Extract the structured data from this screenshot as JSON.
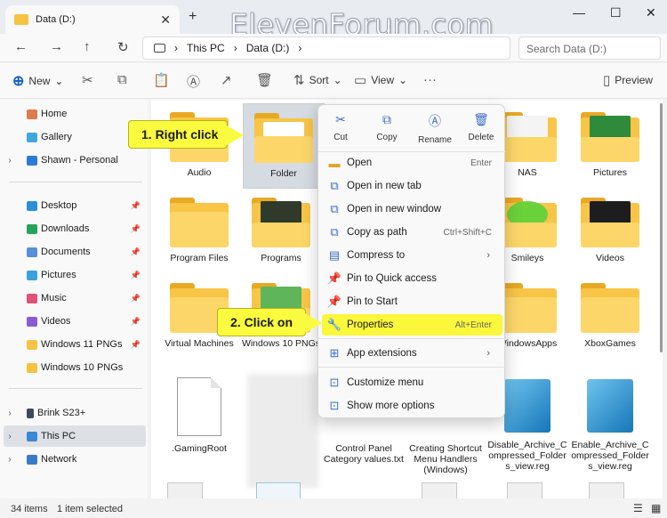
{
  "window": {
    "tab_title": "Data (D:)",
    "watermark": "ElevenForum.com"
  },
  "address": {
    "crumbs": [
      "This PC",
      "Data (D:)"
    ],
    "search_placeholder": "Search Data (D:)"
  },
  "toolbar": {
    "new_label": "New",
    "sort_label": "Sort",
    "view_label": "View",
    "preview_label": "Preview"
  },
  "sidebar": {
    "items": [
      {
        "label": "Home"
      },
      {
        "label": "Gallery"
      },
      {
        "label": "Shawn - Personal"
      },
      {
        "label": "Desktop"
      },
      {
        "label": "Downloads"
      },
      {
        "label": "Documents"
      },
      {
        "label": "Pictures"
      },
      {
        "label": "Music"
      },
      {
        "label": "Videos"
      },
      {
        "label": "Windows 11 PNGs"
      },
      {
        "label": "Windows 10 PNGs"
      },
      {
        "label": "Brink S23+"
      },
      {
        "label": "This PC"
      },
      {
        "label": "Network"
      }
    ]
  },
  "files": {
    "row1": [
      "Audio",
      "Folder",
      "NAS",
      "Pictures"
    ],
    "row2": [
      "Program Files",
      "Programs",
      "Smileys",
      "Videos"
    ],
    "row3": [
      "Virtual Machines",
      "Windows 10 PNGs",
      "WindowsApps",
      "XboxGames"
    ],
    "row4": [
      ".GamingRoot",
      "Control Panel Category values.txt",
      "Creating Shortcut Menu Handlers (Windows)",
      "Disable_Archive_Compressed_Folders_view.reg",
      "Enable_Archive_Compressed_Folders_view.reg"
    ]
  },
  "context_menu": {
    "quick_actions": [
      "Cut",
      "Copy",
      "Rename",
      "Delete"
    ],
    "items": [
      {
        "label": "Open",
        "shortcut": "Enter"
      },
      {
        "label": "Open in new tab",
        "shortcut": ""
      },
      {
        "label": "Open in new window",
        "shortcut": ""
      },
      {
        "label": "Copy as path",
        "shortcut": "Ctrl+Shift+C"
      },
      {
        "label": "Compress to",
        "shortcut": ""
      },
      {
        "label": "Pin to Quick access",
        "shortcut": ""
      },
      {
        "label": "Pin to Start",
        "shortcut": ""
      },
      {
        "label": "Properties",
        "shortcut": "Alt+Enter"
      },
      {
        "label": "App extensions",
        "shortcut": ""
      },
      {
        "label": "Customize menu",
        "shortcut": ""
      },
      {
        "label": "Show more options",
        "shortcut": ""
      }
    ]
  },
  "callouts": {
    "step1": "1. Right click",
    "step2": "2. Click on"
  },
  "status": {
    "count": "34 items",
    "selected": "1 item selected"
  },
  "colors": {
    "highlight": "#fbf73a",
    "accent": "#3a6cc6",
    "folder": "#f8c547"
  }
}
